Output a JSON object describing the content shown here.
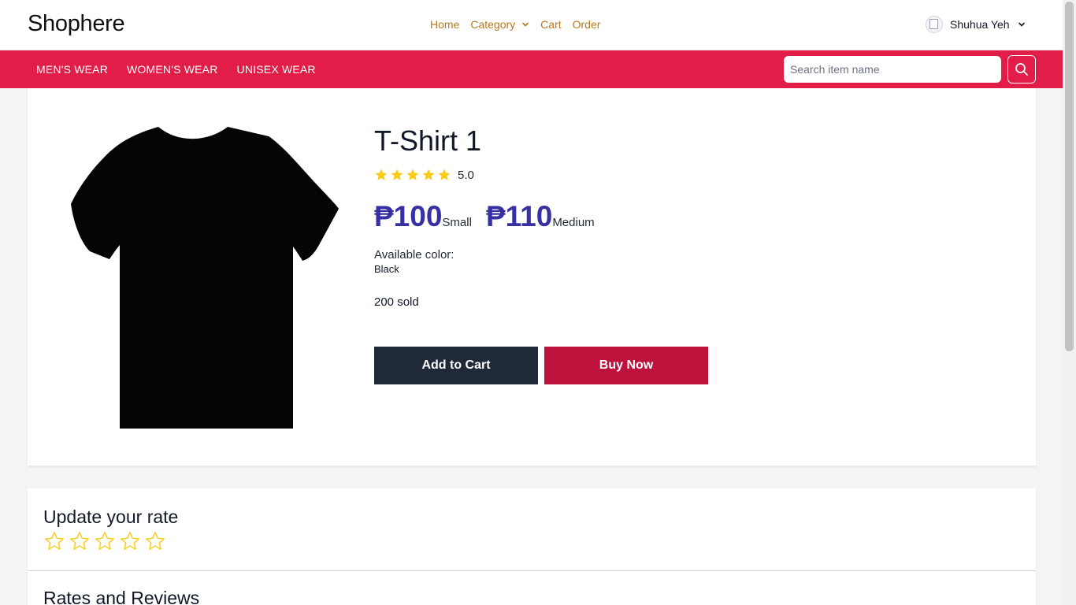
{
  "header": {
    "brand": "Shophere",
    "nav": [
      {
        "label": "Home"
      },
      {
        "label": "Category",
        "has_dropdown": true
      },
      {
        "label": "Cart"
      },
      {
        "label": "Order"
      }
    ],
    "user_name": "Shuhua Yeh",
    "nav_color": "#b7791f"
  },
  "category_bar": {
    "color": "#e11d48",
    "links": [
      "MEN'S WEAR",
      "WOMEN'S WEAR",
      "UNISEX WEAR"
    ],
    "search_placeholder": "Search item name",
    "search_icon": "search-icon"
  },
  "product": {
    "title": "T-Shirt 1",
    "rating": 5,
    "rating_text": "5.0",
    "prices": [
      {
        "price": "₱100",
        "size": "Small"
      },
      {
        "price": "₱110",
        "size": "Medium"
      }
    ],
    "color_label": "Available color:",
    "color_value": "Black",
    "sold": "200 sold",
    "add_to_cart": "Add to Cart",
    "buy_now": "Buy Now",
    "price_color": "#3730a3",
    "cart_button_color": "#1f2937",
    "buy_button_color": "#be123c",
    "star_color": "#facc15"
  },
  "rating_section": {
    "title": "Update your rate",
    "stars_selected": 0,
    "reviews_title": "Rates and Reviews"
  }
}
